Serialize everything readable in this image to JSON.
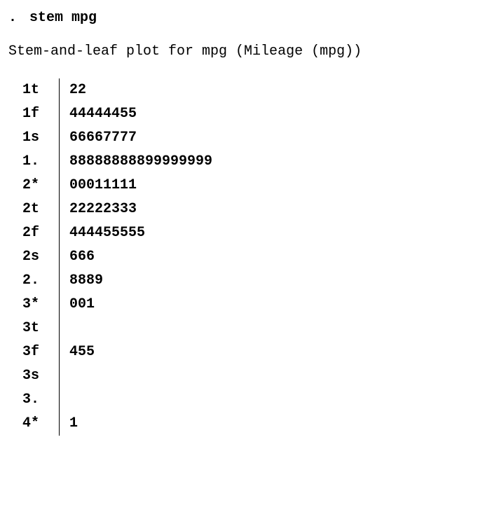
{
  "command": "stem mpg",
  "title": "Stem-and-leaf plot for mpg (Mileage (mpg))",
  "chart_data": {
    "type": "table",
    "subtype": "stem-and-leaf",
    "variable": "mpg",
    "label": "Mileage (mpg)",
    "stem_unit": 10,
    "leaf_unit": 1,
    "rows": [
      {
        "stem": "1t",
        "leaf": "22"
      },
      {
        "stem": "1f",
        "leaf": "44444455"
      },
      {
        "stem": "1s",
        "leaf": "66667777"
      },
      {
        "stem": "1.",
        "leaf": "88888888899999999"
      },
      {
        "stem": "2*",
        "leaf": "00011111"
      },
      {
        "stem": "2t",
        "leaf": "22222333"
      },
      {
        "stem": "2f",
        "leaf": "444455555"
      },
      {
        "stem": "2s",
        "leaf": "666"
      },
      {
        "stem": "2.",
        "leaf": "8889"
      },
      {
        "stem": "3*",
        "leaf": "001"
      },
      {
        "stem": "3t",
        "leaf": ""
      },
      {
        "stem": "3f",
        "leaf": "455"
      },
      {
        "stem": "3s",
        "leaf": ""
      },
      {
        "stem": "3.",
        "leaf": ""
      },
      {
        "stem": "4*",
        "leaf": "1"
      }
    ]
  }
}
